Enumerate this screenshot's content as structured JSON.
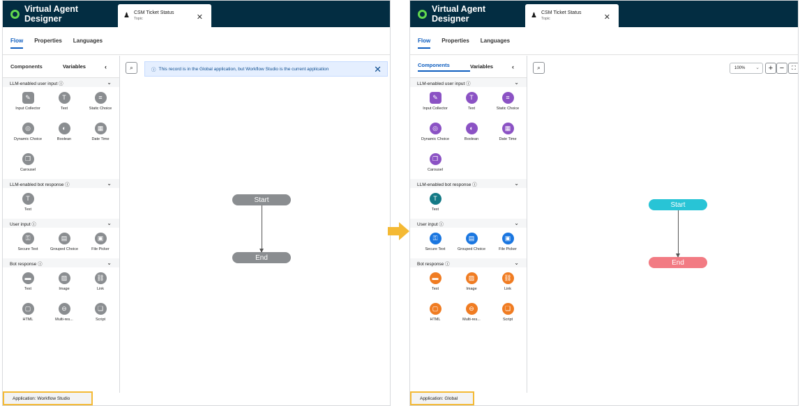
{
  "app": {
    "title": "Virtual Agent Designer"
  },
  "tab": {
    "title": "CSM Ticket Status",
    "subtitle": "Topic"
  },
  "subtabs": [
    "Flow",
    "Properties",
    "Languages"
  ],
  "sidebar": {
    "components_label": "Components",
    "variables_label": "Variables"
  },
  "sections": [
    {
      "title": "LLM-enabled user input ⓘ",
      "items": [
        {
          "label": "Input Collector",
          "icon": "input-collector-icon"
        },
        {
          "label": "Text",
          "icon": "text-icon"
        },
        {
          "label": "Static Choice",
          "icon": "static-choice-icon"
        },
        {
          "label": "Dynamic Choice",
          "icon": "dynamic-choice-icon"
        },
        {
          "label": "Boolean",
          "icon": "boolean-icon"
        },
        {
          "label": "Date Time",
          "icon": "date-time-icon"
        },
        {
          "label": "Carousel",
          "icon": "carousel-icon"
        }
      ]
    },
    {
      "title": "LLM-enabled bot response ⓘ",
      "items": [
        {
          "label": "Text",
          "icon": "text-icon"
        }
      ]
    },
    {
      "title": "User input ⓘ",
      "items": [
        {
          "label": "Secure Text",
          "icon": "secure-text-icon"
        },
        {
          "label": "Grouped Choice",
          "icon": "grouped-choice-icon"
        },
        {
          "label": "File Picker",
          "icon": "file-picker-icon"
        }
      ]
    },
    {
      "title": "Bot response ⓘ",
      "items": [
        {
          "label": "Text",
          "icon": "text-icon"
        },
        {
          "label": "Image",
          "icon": "image-icon"
        },
        {
          "label": "Link",
          "icon": "link-icon"
        },
        {
          "label": "HTML",
          "icon": "html-icon"
        },
        {
          "label": "Multi-res...",
          "icon": "multi-response-icon"
        },
        {
          "label": "Script",
          "icon": "script-icon"
        }
      ]
    }
  ],
  "banner": {
    "text": "This record is in the Global application, but Workflow Studio is the current application"
  },
  "zoom": {
    "value": "100%"
  },
  "flow": {
    "start": "Start",
    "end": "End"
  },
  "footers": {
    "left": "Application: Workflow Studio",
    "right": "Application: Global"
  },
  "colors": {
    "header": "#032d42",
    "accent": "#0d5dbf",
    "highlight": "#f4b934",
    "start_node": "#28c4d6",
    "end_node": "#f27b83",
    "llm_purple": "#8b52c4",
    "llm_bot_teal": "#147a86",
    "user_input_blue": "#1a76e0",
    "bot_response_orange": "#f07c22",
    "disabled_gray": "#8a8d90"
  }
}
